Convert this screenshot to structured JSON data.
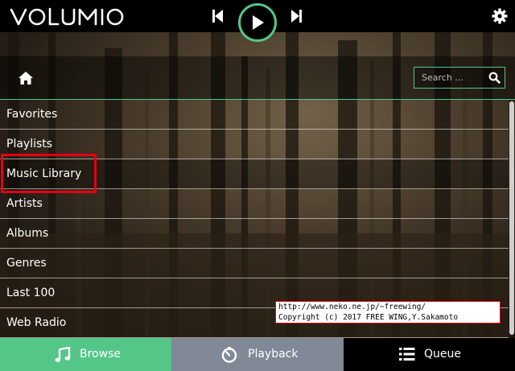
{
  "app": {
    "logo_text": "volumio"
  },
  "search": {
    "placeholder": "Search ..."
  },
  "browse": {
    "items": [
      {
        "label": "Favorites"
      },
      {
        "label": "Playlists"
      },
      {
        "label": "Music Library",
        "selected": true
      },
      {
        "label": "Artists"
      },
      {
        "label": "Albums"
      },
      {
        "label": "Genres"
      },
      {
        "label": "Last 100"
      },
      {
        "label": "Web Radio"
      }
    ]
  },
  "watermark": {
    "line1": "http://www.neko.ne.jp/~freewing/",
    "line2": "Copyright (c) 2017 FREE WING,Y.Sakamoto"
  },
  "tabs": {
    "browse": "Browse",
    "playback": "Playback",
    "queue": "Queue"
  },
  "colors": {
    "accent": "#54c688",
    "highlight": "#e60012",
    "playback_tab": "#818896",
    "queue_tab": "#000000"
  },
  "icons": {
    "prev": "skip-previous-icon",
    "play": "play-icon",
    "next": "skip-next-icon",
    "settings": "gear-icon",
    "home": "home-icon",
    "search": "search-icon",
    "browse": "music-note-icon",
    "playback": "clock-dial-icon",
    "queue": "list-icon"
  }
}
